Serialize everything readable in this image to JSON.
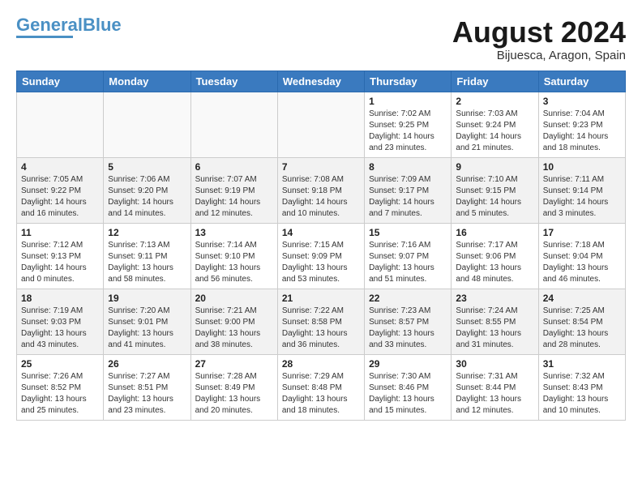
{
  "logo": {
    "part1": "General",
    "part2": "Blue"
  },
  "title": {
    "month_year": "August 2024",
    "location": "Bijuesca, Aragon, Spain"
  },
  "days_of_week": [
    "Sunday",
    "Monday",
    "Tuesday",
    "Wednesday",
    "Thursday",
    "Friday",
    "Saturday"
  ],
  "weeks": [
    [
      {
        "day": "",
        "info": ""
      },
      {
        "day": "",
        "info": ""
      },
      {
        "day": "",
        "info": ""
      },
      {
        "day": "",
        "info": ""
      },
      {
        "day": "1",
        "info": "Sunrise: 7:02 AM\nSunset: 9:25 PM\nDaylight: 14 hours\nand 23 minutes."
      },
      {
        "day": "2",
        "info": "Sunrise: 7:03 AM\nSunset: 9:24 PM\nDaylight: 14 hours\nand 21 minutes."
      },
      {
        "day": "3",
        "info": "Sunrise: 7:04 AM\nSunset: 9:23 PM\nDaylight: 14 hours\nand 18 minutes."
      }
    ],
    [
      {
        "day": "4",
        "info": "Sunrise: 7:05 AM\nSunset: 9:22 PM\nDaylight: 14 hours\nand 16 minutes."
      },
      {
        "day": "5",
        "info": "Sunrise: 7:06 AM\nSunset: 9:20 PM\nDaylight: 14 hours\nand 14 minutes."
      },
      {
        "day": "6",
        "info": "Sunrise: 7:07 AM\nSunset: 9:19 PM\nDaylight: 14 hours\nand 12 minutes."
      },
      {
        "day": "7",
        "info": "Sunrise: 7:08 AM\nSunset: 9:18 PM\nDaylight: 14 hours\nand 10 minutes."
      },
      {
        "day": "8",
        "info": "Sunrise: 7:09 AM\nSunset: 9:17 PM\nDaylight: 14 hours\nand 7 minutes."
      },
      {
        "day": "9",
        "info": "Sunrise: 7:10 AM\nSunset: 9:15 PM\nDaylight: 14 hours\nand 5 minutes."
      },
      {
        "day": "10",
        "info": "Sunrise: 7:11 AM\nSunset: 9:14 PM\nDaylight: 14 hours\nand 3 minutes."
      }
    ],
    [
      {
        "day": "11",
        "info": "Sunrise: 7:12 AM\nSunset: 9:13 PM\nDaylight: 14 hours\nand 0 minutes."
      },
      {
        "day": "12",
        "info": "Sunrise: 7:13 AM\nSunset: 9:11 PM\nDaylight: 13 hours\nand 58 minutes."
      },
      {
        "day": "13",
        "info": "Sunrise: 7:14 AM\nSunset: 9:10 PM\nDaylight: 13 hours\nand 56 minutes."
      },
      {
        "day": "14",
        "info": "Sunrise: 7:15 AM\nSunset: 9:09 PM\nDaylight: 13 hours\nand 53 minutes."
      },
      {
        "day": "15",
        "info": "Sunrise: 7:16 AM\nSunset: 9:07 PM\nDaylight: 13 hours\nand 51 minutes."
      },
      {
        "day": "16",
        "info": "Sunrise: 7:17 AM\nSunset: 9:06 PM\nDaylight: 13 hours\nand 48 minutes."
      },
      {
        "day": "17",
        "info": "Sunrise: 7:18 AM\nSunset: 9:04 PM\nDaylight: 13 hours\nand 46 minutes."
      }
    ],
    [
      {
        "day": "18",
        "info": "Sunrise: 7:19 AM\nSunset: 9:03 PM\nDaylight: 13 hours\nand 43 minutes."
      },
      {
        "day": "19",
        "info": "Sunrise: 7:20 AM\nSunset: 9:01 PM\nDaylight: 13 hours\nand 41 minutes."
      },
      {
        "day": "20",
        "info": "Sunrise: 7:21 AM\nSunset: 9:00 PM\nDaylight: 13 hours\nand 38 minutes."
      },
      {
        "day": "21",
        "info": "Sunrise: 7:22 AM\nSunset: 8:58 PM\nDaylight: 13 hours\nand 36 minutes."
      },
      {
        "day": "22",
        "info": "Sunrise: 7:23 AM\nSunset: 8:57 PM\nDaylight: 13 hours\nand 33 minutes."
      },
      {
        "day": "23",
        "info": "Sunrise: 7:24 AM\nSunset: 8:55 PM\nDaylight: 13 hours\nand 31 minutes."
      },
      {
        "day": "24",
        "info": "Sunrise: 7:25 AM\nSunset: 8:54 PM\nDaylight: 13 hours\nand 28 minutes."
      }
    ],
    [
      {
        "day": "25",
        "info": "Sunrise: 7:26 AM\nSunset: 8:52 PM\nDaylight: 13 hours\nand 25 minutes."
      },
      {
        "day": "26",
        "info": "Sunrise: 7:27 AM\nSunset: 8:51 PM\nDaylight: 13 hours\nand 23 minutes."
      },
      {
        "day": "27",
        "info": "Sunrise: 7:28 AM\nSunset: 8:49 PM\nDaylight: 13 hours\nand 20 minutes."
      },
      {
        "day": "28",
        "info": "Sunrise: 7:29 AM\nSunset: 8:48 PM\nDaylight: 13 hours\nand 18 minutes."
      },
      {
        "day": "29",
        "info": "Sunrise: 7:30 AM\nSunset: 8:46 PM\nDaylight: 13 hours\nand 15 minutes."
      },
      {
        "day": "30",
        "info": "Sunrise: 7:31 AM\nSunset: 8:44 PM\nDaylight: 13 hours\nand 12 minutes."
      },
      {
        "day": "31",
        "info": "Sunrise: 7:32 AM\nSunset: 8:43 PM\nDaylight: 13 hours\nand 10 minutes."
      }
    ]
  ]
}
